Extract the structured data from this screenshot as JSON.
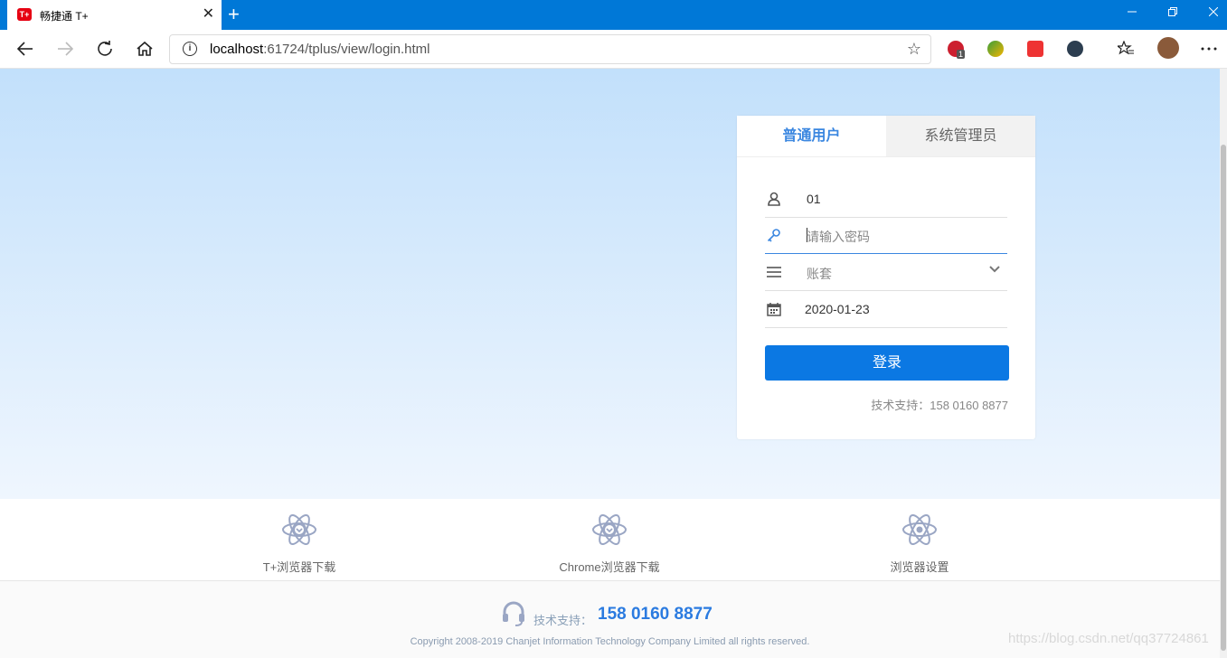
{
  "browser": {
    "tab_title": "畅捷通 T+",
    "favicon_text": "T+",
    "close_glyph": "✕",
    "new_tab_glyph": "+",
    "url_host": "localhost",
    "url_rest": ":61724/tplus/view/login.html",
    "icons": [
      "back-icon",
      "forward-icon",
      "refresh-icon",
      "home-icon",
      "info-icon",
      "star-icon",
      "adblock-icon",
      "extension-icon",
      "todoist-icon",
      "ghostery-icon",
      "favorites-icon",
      "profile-avatar",
      "more-icon"
    ],
    "adblock_badge": "1"
  },
  "login": {
    "tab_user": "普通用户",
    "tab_admin": "系统管理员",
    "username_value": "01",
    "password_placeholder": "请输入密码",
    "account_set_placeholder": "账套",
    "date_value": "2020-01-23",
    "submit_label": "登录",
    "support_text": "技术支持：158 0160 8877"
  },
  "downloads": [
    {
      "label": "T+浏览器下载",
      "icon": "atom-download-icon"
    },
    {
      "label": "Chrome浏览器下载",
      "icon": "atom-download-icon"
    },
    {
      "label": "浏览器设置",
      "icon": "atom-settings-icon"
    }
  ],
  "footer": {
    "support_label": "技术支持：",
    "support_number": "158 0160 8877",
    "copyright": "Copyright 2008-2019 Chanjet Information Technology Company Limited all rights reserved."
  },
  "watermark": "https://blog.csdn.net/qq37724861",
  "colors": {
    "titlebar": "#0078d7",
    "accent": "#0b78e3",
    "tab_active_text": "#3b87e0",
    "hero_top": "#c2e0fb",
    "hero_bottom": "#eff6fe"
  }
}
